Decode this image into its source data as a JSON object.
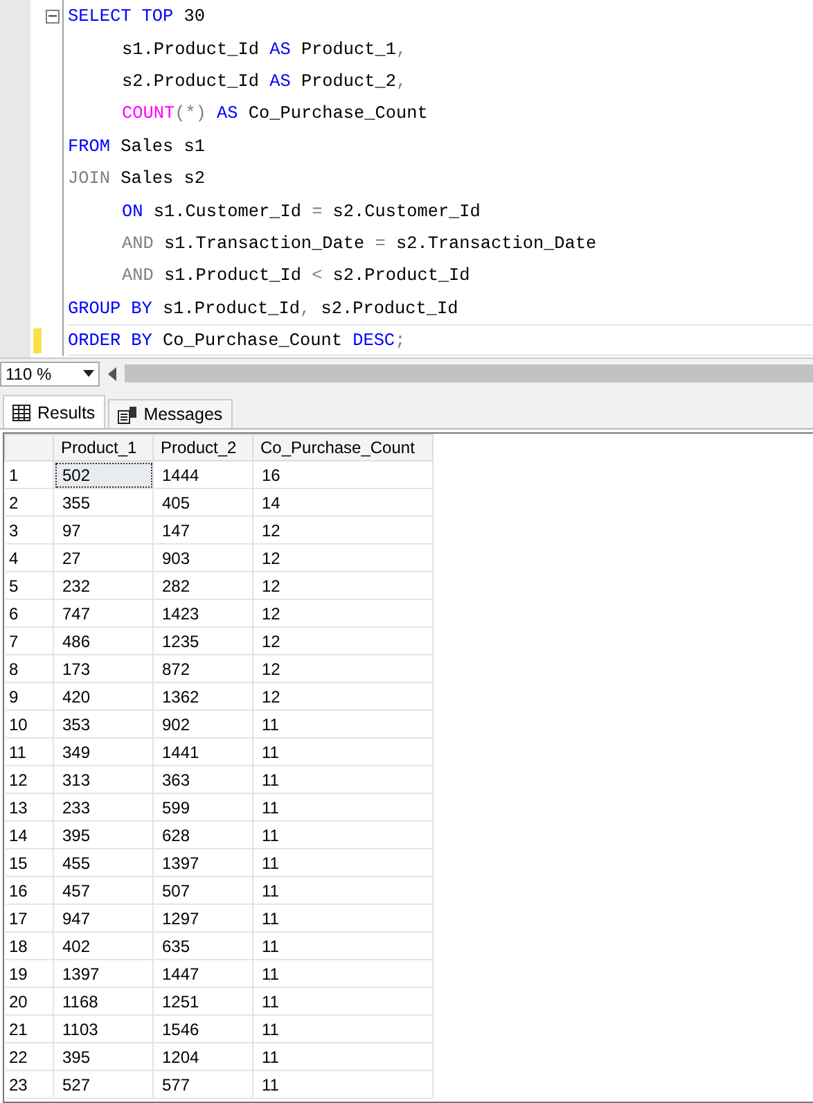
{
  "editor": {
    "lines": [
      {
        "indent": false,
        "changed": false,
        "fold": true,
        "tokens": [
          {
            "kind": "keyword",
            "text": "SELECT TOP"
          },
          {
            "kind": "plain",
            "text": " 30"
          }
        ]
      },
      {
        "indent": true,
        "changed": false,
        "fold": false,
        "tokens": [
          {
            "kind": "plain",
            "text": "s1.Product_Id "
          },
          {
            "kind": "keyword",
            "text": "AS"
          },
          {
            "kind": "plain",
            "text": " Product_1"
          },
          {
            "kind": "operator",
            "text": ","
          }
        ]
      },
      {
        "indent": true,
        "changed": false,
        "fold": false,
        "tokens": [
          {
            "kind": "plain",
            "text": "s2.Product_Id "
          },
          {
            "kind": "keyword",
            "text": "AS"
          },
          {
            "kind": "plain",
            "text": " Product_2"
          },
          {
            "kind": "operator",
            "text": ","
          }
        ]
      },
      {
        "indent": true,
        "changed": false,
        "fold": false,
        "tokens": [
          {
            "kind": "function",
            "text": "COUNT"
          },
          {
            "kind": "operator",
            "text": "(*)"
          },
          {
            "kind": "keyword",
            "text": " AS"
          },
          {
            "kind": "plain",
            "text": " Co_Purchase_Count"
          }
        ]
      },
      {
        "indent": false,
        "changed": false,
        "fold": false,
        "tokens": [
          {
            "kind": "keyword",
            "text": "FROM"
          },
          {
            "kind": "plain",
            "text": " Sales s1"
          }
        ]
      },
      {
        "indent": false,
        "changed": false,
        "fold": false,
        "tokens": [
          {
            "kind": "operator",
            "text": "JOIN"
          },
          {
            "kind": "plain",
            "text": " Sales s2"
          }
        ]
      },
      {
        "indent": true,
        "changed": false,
        "fold": false,
        "tokens": [
          {
            "kind": "keyword",
            "text": "ON"
          },
          {
            "kind": "plain",
            "text": " s1.Customer_Id "
          },
          {
            "kind": "operator",
            "text": "="
          },
          {
            "kind": "plain",
            "text": " s2.Customer_Id"
          }
        ]
      },
      {
        "indent": true,
        "changed": false,
        "fold": false,
        "tokens": [
          {
            "kind": "operator",
            "text": "AND"
          },
          {
            "kind": "plain",
            "text": " s1.Transaction_Date "
          },
          {
            "kind": "operator",
            "text": "="
          },
          {
            "kind": "plain",
            "text": " s2.Transaction_Date"
          }
        ]
      },
      {
        "indent": true,
        "changed": false,
        "fold": false,
        "tokens": [
          {
            "kind": "operator",
            "text": "AND"
          },
          {
            "kind": "plain",
            "text": " s1.Product_Id "
          },
          {
            "kind": "operator",
            "text": "<"
          },
          {
            "kind": "plain",
            "text": " s2.Product_Id"
          }
        ]
      },
      {
        "indent": false,
        "changed": false,
        "fold": false,
        "tokens": [
          {
            "kind": "keyword",
            "text": "GROUP BY"
          },
          {
            "kind": "plain",
            "text": " s1.Product_Id"
          },
          {
            "kind": "operator",
            "text": ","
          },
          {
            "kind": "plain",
            "text": " s2.Product_Id"
          }
        ]
      },
      {
        "indent": false,
        "changed": true,
        "fold": false,
        "tokens": [
          {
            "kind": "keyword",
            "text": "ORDER BY"
          },
          {
            "kind": "plain",
            "text": " Co_Purchase_Count "
          },
          {
            "kind": "keyword",
            "text": "DESC"
          },
          {
            "kind": "operator",
            "text": ";"
          }
        ]
      }
    ]
  },
  "zoom": "110 %",
  "tabs": [
    {
      "label": "Results",
      "selected": true
    },
    {
      "label": "Messages",
      "selected": false
    }
  ],
  "table": {
    "columns": [
      "Product_1",
      "Product_2",
      "Co_Purchase_Count"
    ],
    "rows": [
      {
        "n": "1",
        "cells": [
          "502",
          "1444",
          "16"
        ],
        "selected": true
      },
      {
        "n": "2",
        "cells": [
          "355",
          "405",
          "14"
        ],
        "selected": false
      },
      {
        "n": "3",
        "cells": [
          "97",
          "147",
          "12"
        ],
        "selected": false
      },
      {
        "n": "4",
        "cells": [
          "27",
          "903",
          "12"
        ],
        "selected": false
      },
      {
        "n": "5",
        "cells": [
          "232",
          "282",
          "12"
        ],
        "selected": false
      },
      {
        "n": "6",
        "cells": [
          "747",
          "1423",
          "12"
        ],
        "selected": false
      },
      {
        "n": "7",
        "cells": [
          "486",
          "1235",
          "12"
        ],
        "selected": false
      },
      {
        "n": "8",
        "cells": [
          "173",
          "872",
          "12"
        ],
        "selected": false
      },
      {
        "n": "9",
        "cells": [
          "420",
          "1362",
          "12"
        ],
        "selected": false
      },
      {
        "n": "10",
        "cells": [
          "353",
          "902",
          "11"
        ],
        "selected": false
      },
      {
        "n": "11",
        "cells": [
          "349",
          "1441",
          "11"
        ],
        "selected": false
      },
      {
        "n": "12",
        "cells": [
          "313",
          "363",
          "11"
        ],
        "selected": false
      },
      {
        "n": "13",
        "cells": [
          "233",
          "599",
          "11"
        ],
        "selected": false
      },
      {
        "n": "14",
        "cells": [
          "395",
          "628",
          "11"
        ],
        "selected": false
      },
      {
        "n": "15",
        "cells": [
          "455",
          "1397",
          "11"
        ],
        "selected": false
      },
      {
        "n": "16",
        "cells": [
          "457",
          "507",
          "11"
        ],
        "selected": false
      },
      {
        "n": "17",
        "cells": [
          "947",
          "1297",
          "11"
        ],
        "selected": false
      },
      {
        "n": "18",
        "cells": [
          "402",
          "635",
          "11"
        ],
        "selected": false
      },
      {
        "n": "19",
        "cells": [
          "1397",
          "1447",
          "11"
        ],
        "selected": false
      },
      {
        "n": "20",
        "cells": [
          "1168",
          "1251",
          "11"
        ],
        "selected": false
      },
      {
        "n": "21",
        "cells": [
          "1103",
          "1546",
          "11"
        ],
        "selected": false
      },
      {
        "n": "22",
        "cells": [
          "395",
          "1204",
          "11"
        ],
        "selected": false
      },
      {
        "n": "23",
        "cells": [
          "527",
          "577",
          "11"
        ],
        "selected": false
      }
    ]
  }
}
